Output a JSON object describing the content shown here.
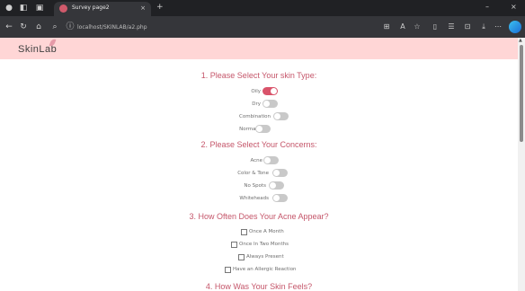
{
  "browser": {
    "tab_title": "Survey page2",
    "tab_close": "×",
    "new_tab": "+",
    "url": "localhost/SKINLAB/a2.php",
    "window_min": "–",
    "window_close": "×"
  },
  "header": {
    "logo_text": "SkinLab"
  },
  "sections": [
    {
      "title": "1. Please Select Your skin Type:",
      "options": [
        {
          "label": "Oily",
          "on": true
        },
        {
          "label": "Dry",
          "on": false
        },
        {
          "label": "Combination",
          "on": false
        },
        {
          "label": "Normal",
          "on": false
        }
      ]
    },
    {
      "title": "2. Please Select Your Concerns:",
      "options": [
        {
          "label": "Acne",
          "on": false
        },
        {
          "label": "Color & Tone",
          "on": false
        },
        {
          "label": "No Spots",
          "on": false
        },
        {
          "label": "Whiteheads",
          "on": false
        }
      ]
    },
    {
      "title": "3. How Often Does Your Acne Appear?",
      "options": [
        {
          "label": "Once A Month",
          "checked": false
        },
        {
          "label": "Once In Two Months",
          "checked": false
        },
        {
          "label": "Always Present",
          "checked": false
        },
        {
          "label": "Have an Allergic Reaction",
          "checked": false
        }
      ]
    },
    {
      "title": "4. How Was Your Skin Feels?"
    }
  ],
  "colors": {
    "accent": "#d9536a",
    "header_bg": "#ffd6d6",
    "title": "#c5566a"
  }
}
